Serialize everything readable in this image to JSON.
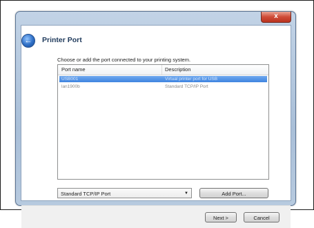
{
  "window": {
    "close_label": "x"
  },
  "wizard": {
    "back_glyph": "←",
    "title": "Printer Port",
    "instructions": "Choose or add the port connected to your printing system."
  },
  "port_list": {
    "columns": [
      "Port name",
      "Description"
    ],
    "rows": [
      {
        "name": "USB001",
        "description": "Virtual printer port for USB",
        "selected": true
      },
      {
        "name": "lan1900b",
        "description": "Standard TCP/IP Port",
        "selected": false
      }
    ]
  },
  "port_type": {
    "selected": "Standard TCP/IP Port"
  },
  "buttons": {
    "add_port": "Add Port...",
    "next": "Next >",
    "cancel": "Cancel"
  }
}
